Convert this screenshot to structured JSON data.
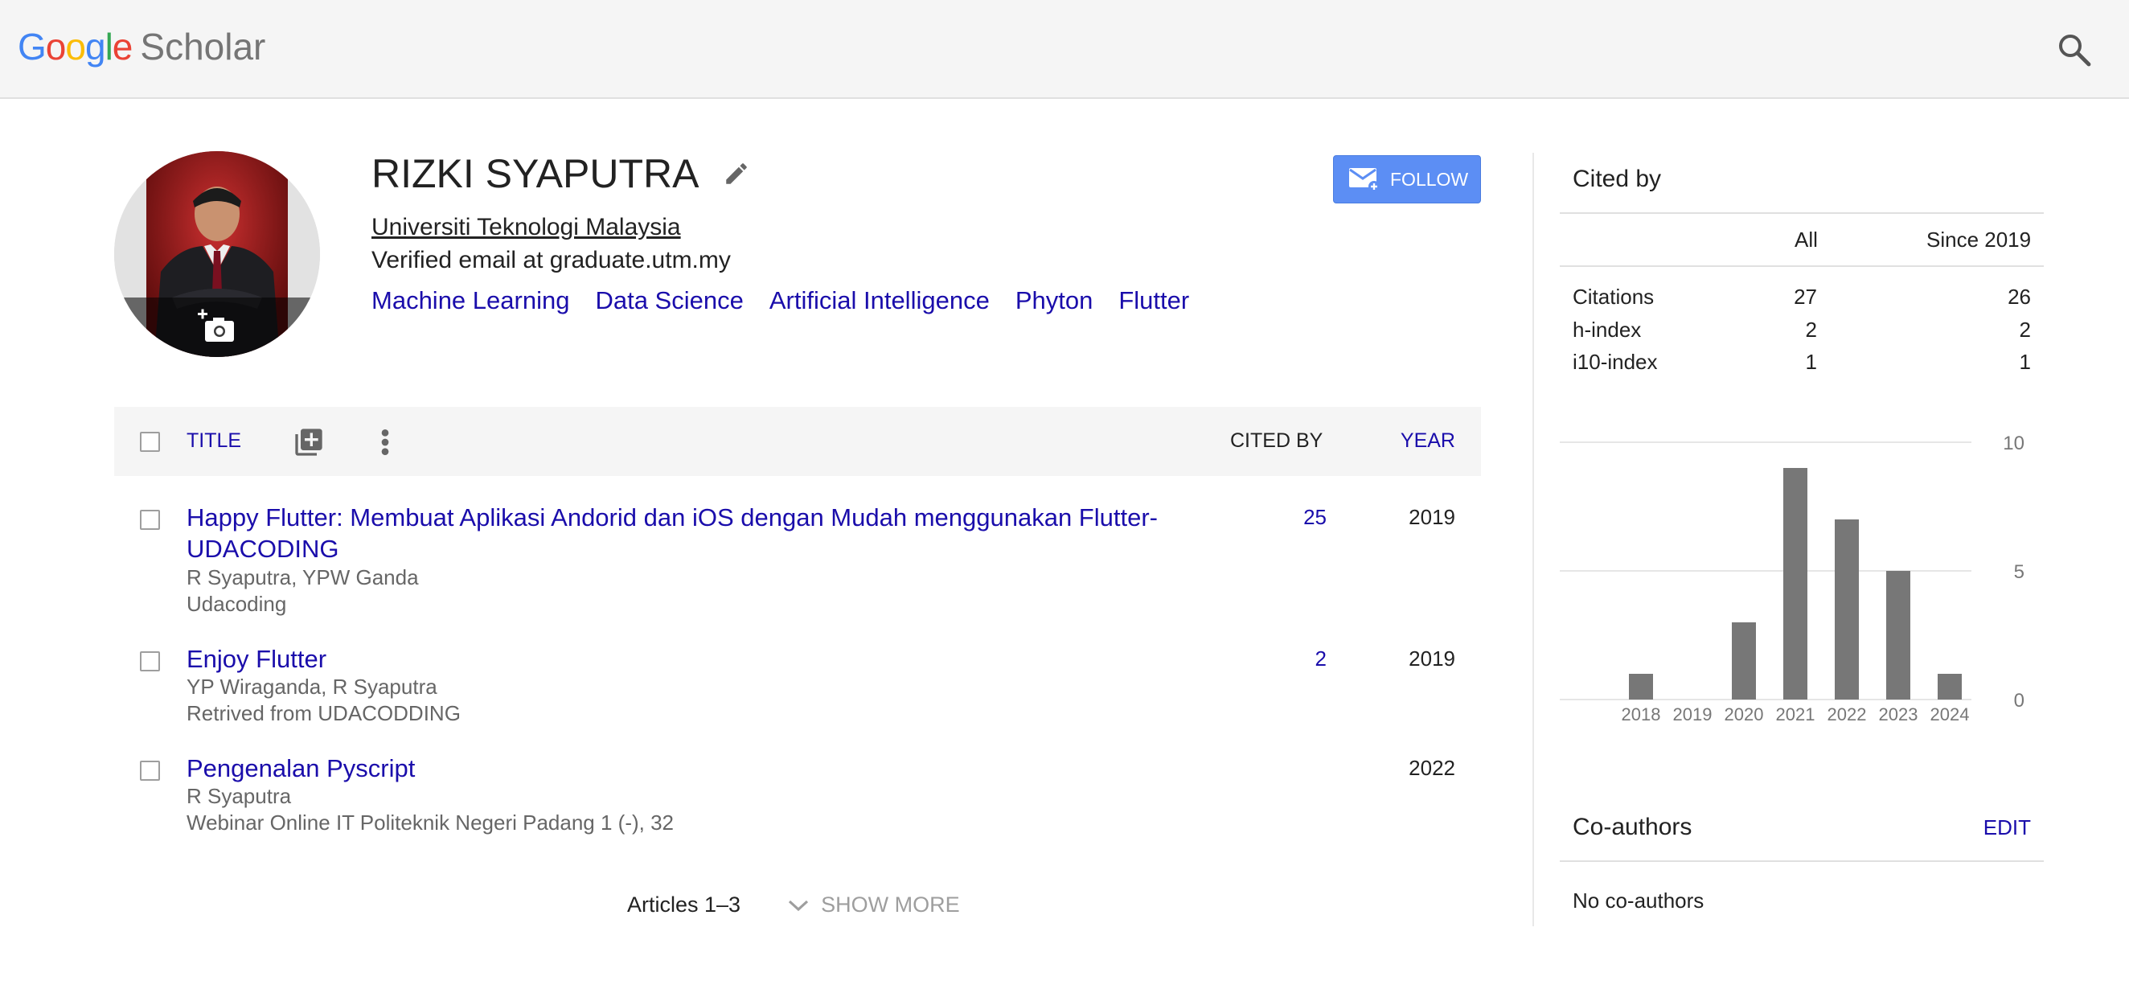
{
  "header": {
    "logo_letters": [
      "G",
      "o",
      "o",
      "g",
      "l",
      "e"
    ],
    "logo_word": "Scholar",
    "search_icon": "search-icon"
  },
  "profile": {
    "name": "RIZKI SYAPUTRA",
    "affiliation": "Universiti Teknologi Malaysia",
    "email": "Verified email at graduate.utm.my",
    "interests": [
      "Machine Learning",
      "Data Science",
      "Artificial Intelligence",
      "Phyton",
      "Flutter"
    ],
    "follow_label": "FOLLOW"
  },
  "table": {
    "header": {
      "title": "TITLE",
      "cited_by": "CITED BY",
      "year": "YEAR"
    },
    "rows": [
      {
        "title": "Happy Flutter: Membuat Aplikasi Andorid dan iOS dengan Mudah menggunakan Flutter-UDACODING",
        "authors": "R Syaputra, YPW Ganda",
        "venue": "Udacoding",
        "cited": "25",
        "year": "2019"
      },
      {
        "title": "Enjoy Flutter",
        "authors": "YP Wiraganda, R Syaputra",
        "venue": "Retrived from UDACODDING",
        "cited": "2",
        "year": "2019"
      },
      {
        "title": "Pengenalan Pyscript",
        "authors": "R Syaputra",
        "venue": "Webinar Online IT Politeknik Negeri Padang 1 (-), 32",
        "cited": "",
        "year": "2022"
      }
    ],
    "articles_count": "Articles 1–3",
    "show_more": "SHOW MORE"
  },
  "cited_by": {
    "title": "Cited by",
    "columns": [
      "All",
      "Since 2019"
    ],
    "rows": [
      {
        "label": "Citations",
        "all": "27",
        "since": "26"
      },
      {
        "label": "h-index",
        "all": "2",
        "since": "2"
      },
      {
        "label": "i10-index",
        "all": "1",
        "since": "1"
      }
    ]
  },
  "chart_data": {
    "type": "bar",
    "categories": [
      "2018",
      "2019",
      "2020",
      "2021",
      "2022",
      "2023",
      "2024"
    ],
    "values": [
      1,
      0,
      3,
      9,
      7,
      5,
      1
    ],
    "ylim": [
      0,
      10
    ],
    "yticks": [
      "0",
      "5",
      "10"
    ],
    "bar_color": "#777777",
    "grid": true
  },
  "coauthors": {
    "title": "Co-authors",
    "edit_label": "EDIT",
    "empty_text": "No co-authors"
  },
  "colors": {
    "link": "#1a0dab",
    "follow_bg": "#5c8ef4",
    "topbar_bg": "#f5f5f5"
  }
}
